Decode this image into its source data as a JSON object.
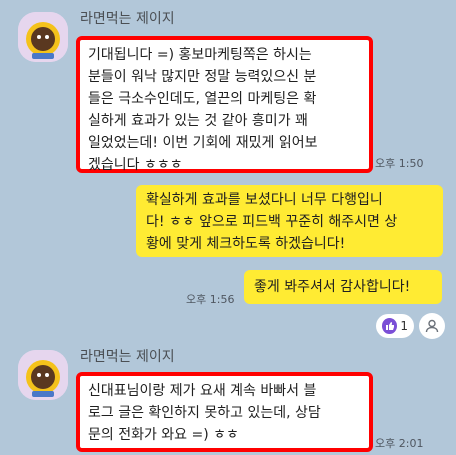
{
  "messages": [
    {
      "sender": "라면먹는 제이지",
      "lines": [
        "기대됩니다 =) 홍보마케팅쪽은 하시는",
        "분들이 워낙 많지만 정말 능력있으신 분",
        "들은 극소수인데도, 열끈의 마케팅은 확",
        "실하게 효과가 있는 것 같아 흥미가 꽤",
        "일었었는데! 이번 기회에 재밌게 읽어보",
        "겠습니다 ㅎㅎㅎ"
      ],
      "time": "오후 1:50"
    },
    {
      "lines": [
        "확실하게 효과를 보셨다니 너무 다행입니",
        "다! ㅎㅎ 앞으로 피드백 꾸준히 해주시면 상",
        "황에 맞게 체크하도록 하겠습니다!"
      ]
    },
    {
      "lines": [
        "좋게 봐주셔서 감사합니다!"
      ],
      "time": "오후 1:56",
      "reaction_count": "1"
    },
    {
      "sender": "라면먹는 제이지",
      "lines": [
        "신대표님이랑 제가 요새 계속 바빠서 블",
        "로그 글은 확인하지 못하고 있는데, 상담",
        "문의 전화가 와요 =) ㅎㅎ"
      ],
      "time": "오후 2:01"
    }
  ]
}
